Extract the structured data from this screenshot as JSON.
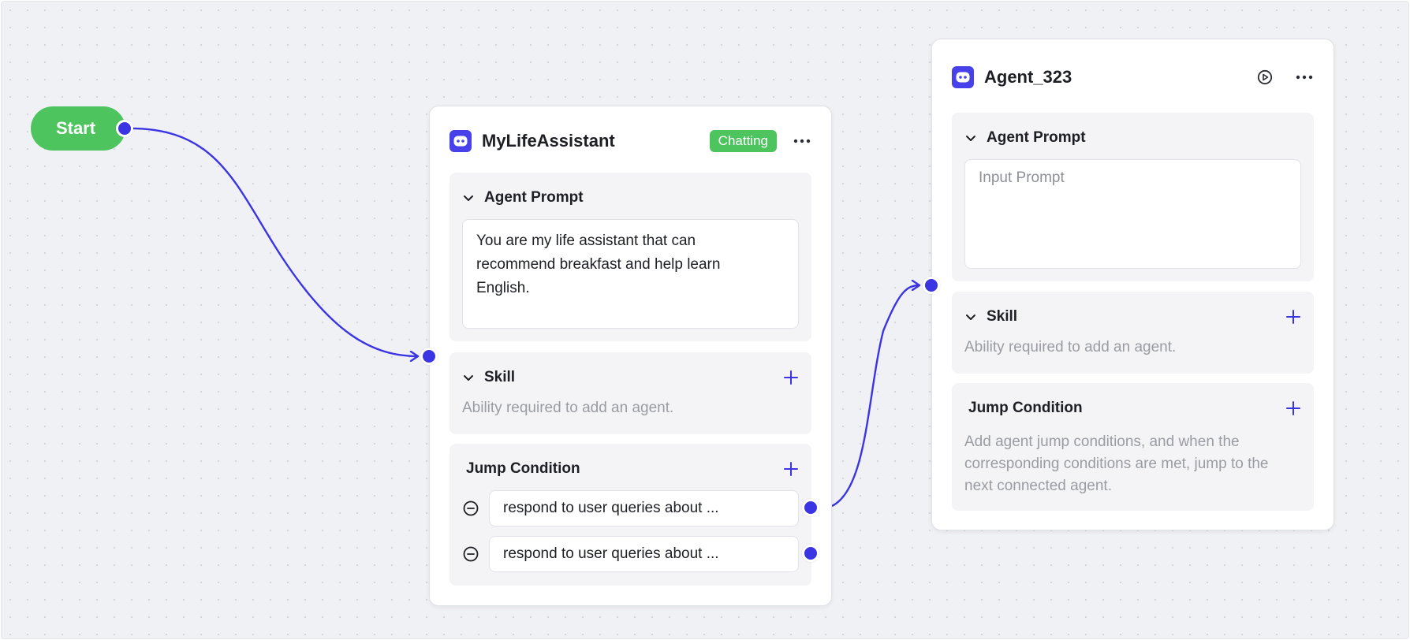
{
  "start": {
    "label": "Start"
  },
  "node1": {
    "title": "MyLifeAssistant",
    "status": "Chatting",
    "agent_prompt": {
      "title": "Agent Prompt",
      "text_lines": [
        "You are my life assistant that can",
        "recommend breakfast and help learn",
        "English."
      ]
    },
    "skill": {
      "title": "Skill",
      "hint": "Ability required to add an agent."
    },
    "jump_condition": {
      "title": "Jump Condition",
      "conditions": [
        "respond to user queries about ...",
        "respond to user queries about ..."
      ]
    }
  },
  "node2": {
    "title": "Agent_323",
    "agent_prompt": {
      "title": "Agent Prompt",
      "placeholder": "Input Prompt"
    },
    "skill": {
      "title": "Skill",
      "hint": "Ability required to add an agent."
    },
    "jump_condition": {
      "title": "Jump Condition",
      "hint_lines": [
        "Add agent jump conditions, and when the",
        "corresponding conditions are met, jump to the",
        "next connected agent."
      ]
    }
  },
  "colors": {
    "accent": "#3b34e2",
    "start_green": "#4dc45e",
    "canvas_bg": "#f0f1f4"
  },
  "icons": [
    "bot-icon",
    "chevron-down-icon",
    "plus-icon",
    "minus-circle-icon",
    "more-icon",
    "play-circle-icon"
  ]
}
